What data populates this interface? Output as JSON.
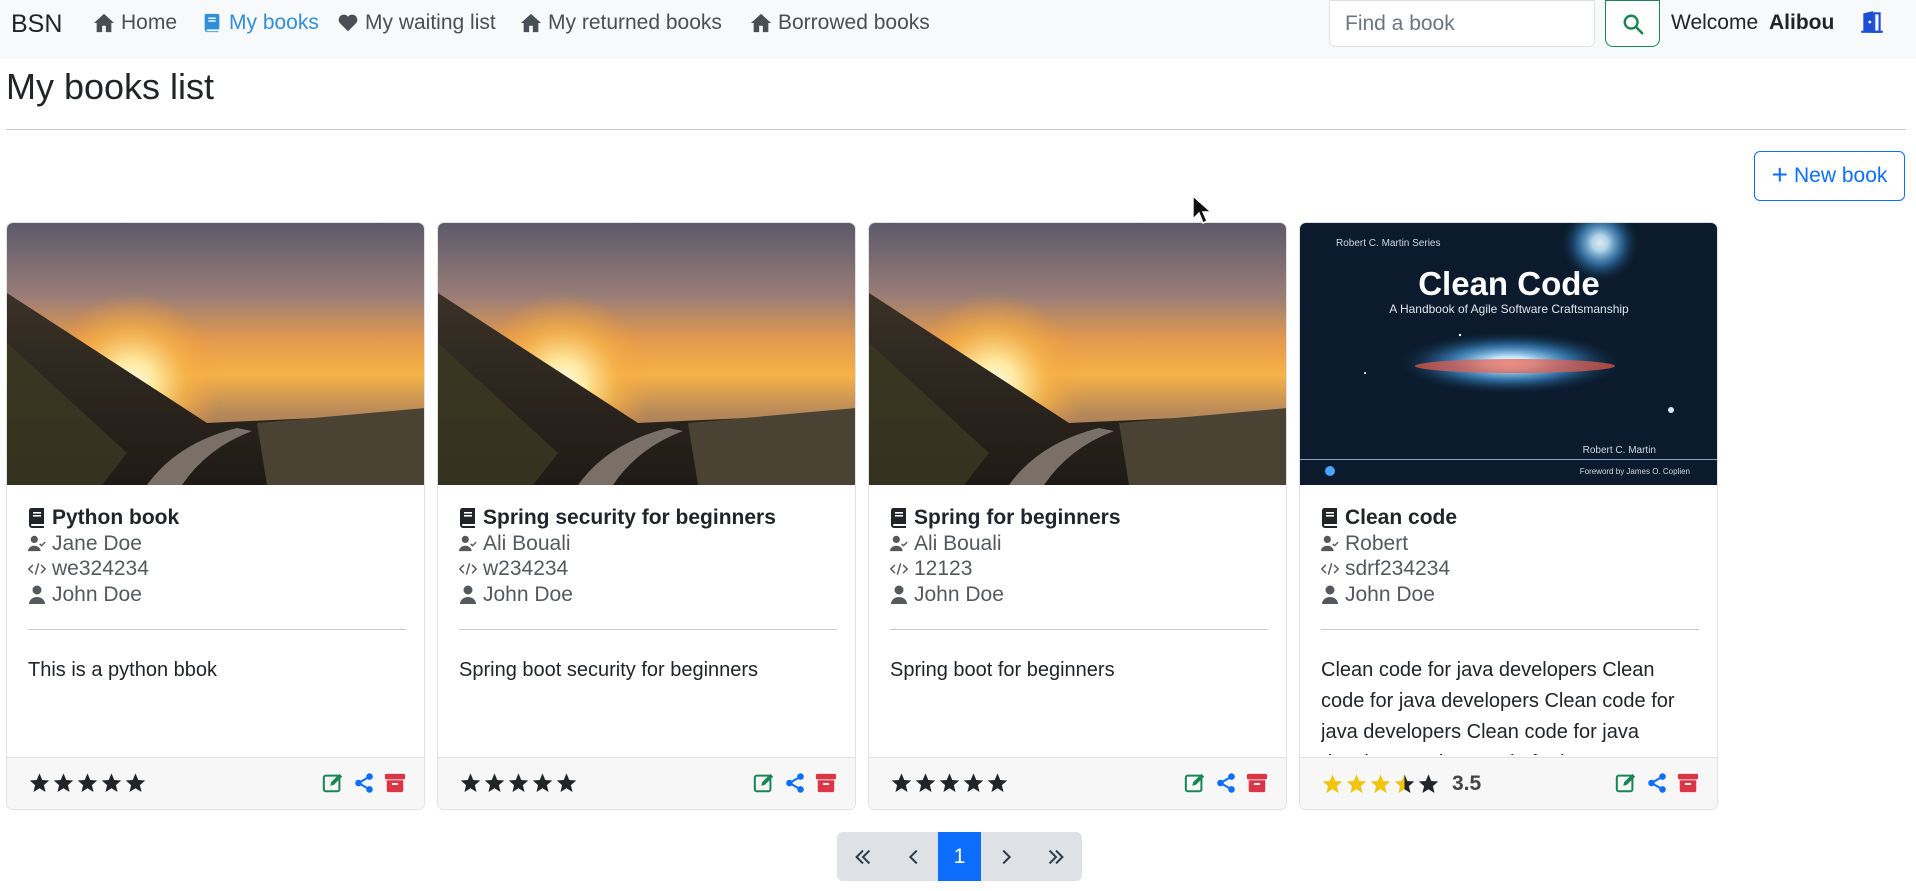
{
  "nav": {
    "brand": "BSN",
    "items": [
      {
        "label": "Home",
        "icon": "home-icon"
      },
      {
        "label": "My books",
        "icon": "book-icon"
      },
      {
        "label": "My waiting list",
        "icon": "heart-icon"
      },
      {
        "label": "My returned books",
        "icon": "home-icon"
      },
      {
        "label": "Borrowed books",
        "icon": "home-icon"
      }
    ],
    "search_placeholder": "Find a book",
    "welcome_label": "Welcome",
    "username": "Alibou"
  },
  "page": {
    "title": "My books list",
    "new_book_label": "New book"
  },
  "books": [
    {
      "title": "Python book",
      "author": "Jane Doe",
      "isbn": "we324234",
      "owner": "John Doe",
      "synopsis": "This is a python bbok",
      "rating": 0,
      "rating_label": "",
      "cover": "sunset-photo"
    },
    {
      "title": "Spring security for beginners",
      "author": "Ali Bouali",
      "isbn": "w234234",
      "owner": "John Doe",
      "synopsis": "Spring boot security for beginners",
      "rating": 0,
      "rating_label": "",
      "cover": "sunset-photo"
    },
    {
      "title": "Spring for beginners",
      "author": "Ali Bouali",
      "isbn": "12123",
      "owner": "John Doe",
      "synopsis": "Spring boot for beginners",
      "rating": 0,
      "rating_label": "",
      "cover": "sunset-photo"
    },
    {
      "title": "Clean code",
      "author": "Robert",
      "isbn": "sdrf234234",
      "owner": "John Doe",
      "synopsis": "Clean code for java developers Clean code for java developers Clean code for java developers Clean code for java developers Clean code for java",
      "rating": 3.5,
      "rating_label": "3.5",
      "cover": "clean-code-cover"
    }
  ],
  "cover_art": {
    "series": "Robert C. Martin Series",
    "title": "Clean Code",
    "subtitle": "A Handbook of Agile Software Craftsmanship",
    "author": "Robert C. Martin",
    "foreword": "Foreword by James O. Coplien"
  },
  "pagination": {
    "current_page": "1",
    "first_icon": "double-chevron-left-icon",
    "prev_icon": "chevron-left-icon",
    "next_icon": "chevron-right-icon",
    "last_icon": "double-chevron-right-icon"
  },
  "colors": {
    "accent": "#0d6efd",
    "active_nav": "#2f8fd8",
    "star_filled": "#f1c40f",
    "star_empty": "#212529",
    "edit": "#198754",
    "share": "#0d6efd",
    "archive": "#dc3545"
  }
}
